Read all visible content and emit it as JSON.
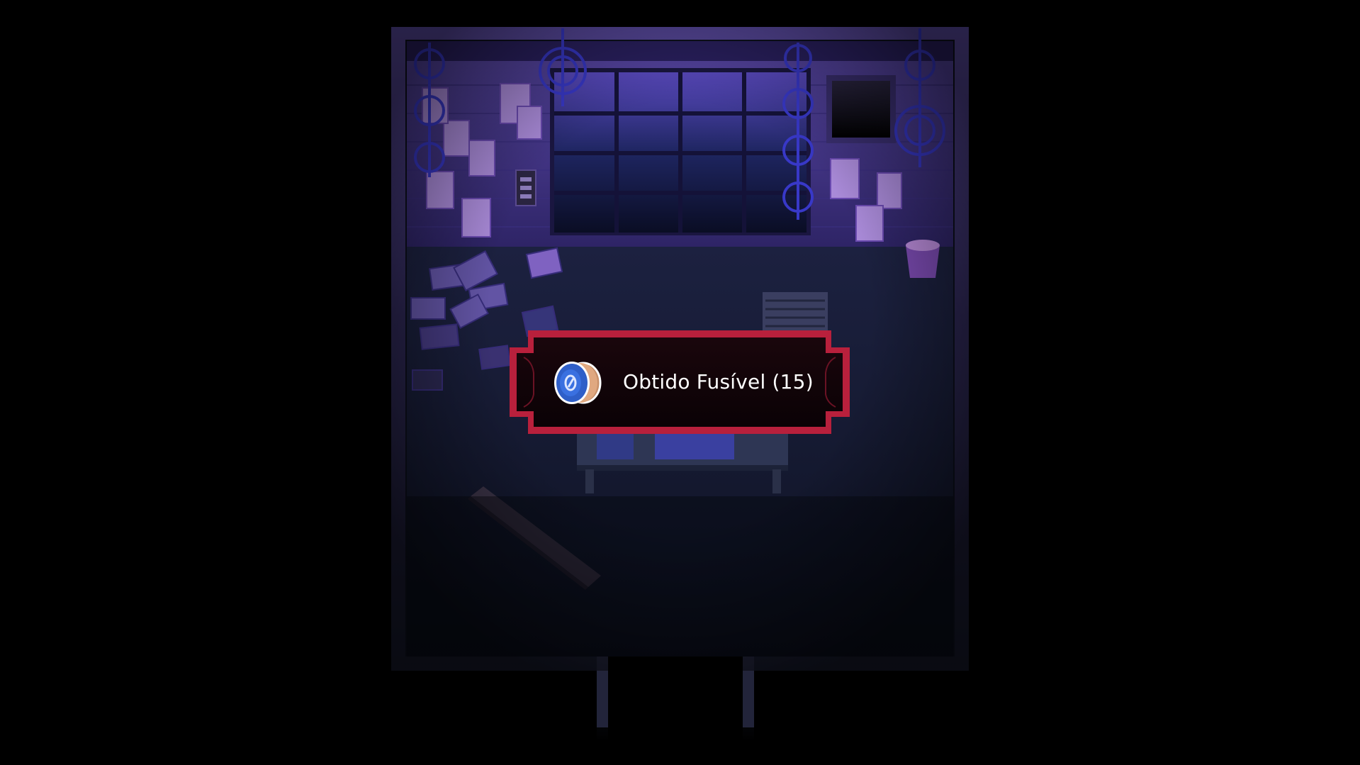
{
  "notification": {
    "text": "Obtido Fusível (15)",
    "item_icon": "fuse-coin-icon"
  },
  "colors": {
    "background": "#000000",
    "wall": "#4a3a8c",
    "floor": "#141a2e",
    "notification_border": "#b8203c",
    "notification_fill": "#120408",
    "fuse_blue": "#2f5fc8"
  }
}
